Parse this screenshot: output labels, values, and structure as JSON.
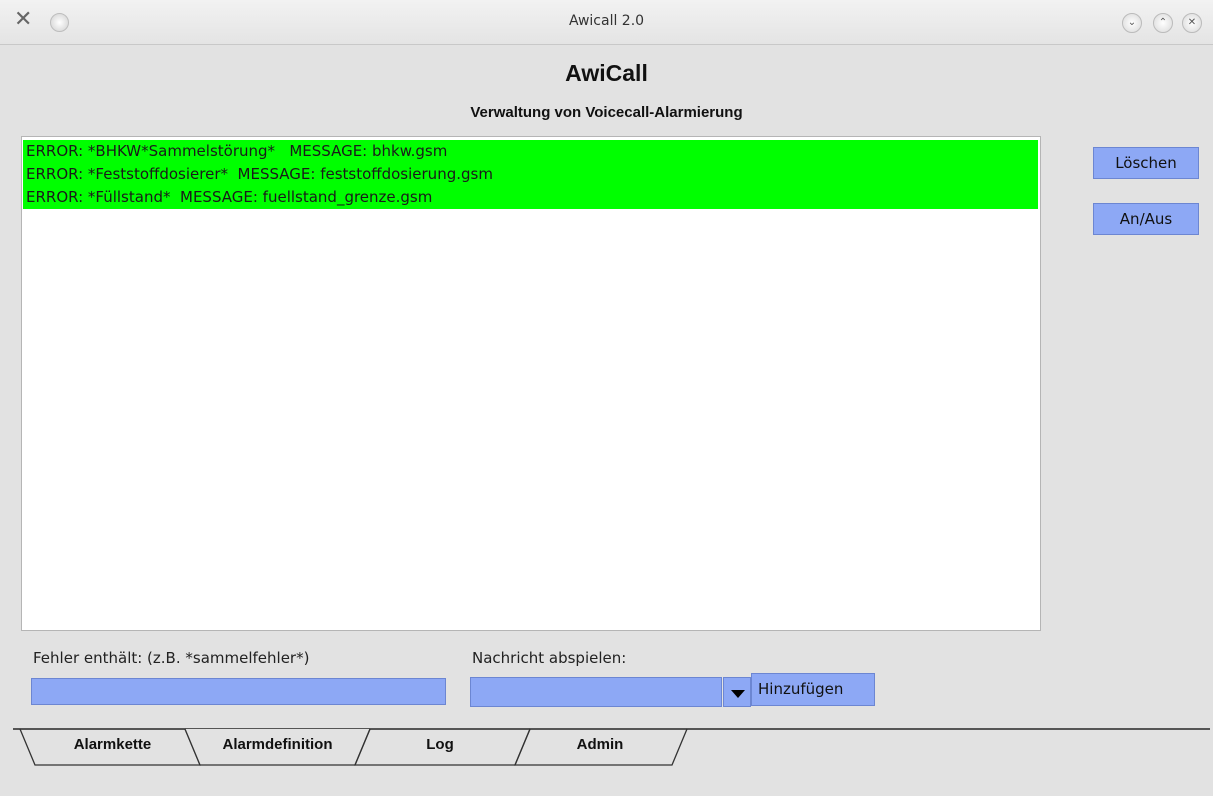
{
  "window": {
    "title": "Awicall 2.0",
    "app_icon": "x-icon",
    "menu_icon": "circle-menu-icon",
    "controls": [
      "minimize-icon",
      "maximize-icon",
      "close-icon"
    ]
  },
  "header": {
    "title": "AwiCall",
    "subtitle": "Verwaltung von Voicecall-Alarmierung"
  },
  "definitions": [
    "ERROR: *BHKW*Sammelstörung*   MESSAGE: bhkw.gsm",
    "ERROR: *Feststoffdosierer*  MESSAGE: feststoffdosierung.gsm",
    "ERROR: *Füllstand*  MESSAGE: fuellstand_grenze.gsm"
  ],
  "buttons": {
    "delete": "Löschen",
    "toggle": "An/Aus",
    "add": "Hinzufügen"
  },
  "form": {
    "error_label": "Fehler enthält: (z.B. *sammelfehler*)",
    "error_value": "",
    "message_label": "Nachricht abspielen:",
    "message_value": ""
  },
  "tabs": [
    {
      "label": "Alarmkette",
      "active": false
    },
    {
      "label": "Alarmdefinition",
      "active": true
    },
    {
      "label": "Log",
      "active": false
    },
    {
      "label": "Admin",
      "active": false
    }
  ],
  "colors": {
    "highlight": "#00ff00",
    "widget": "#8da8f5",
    "background": "#e2e2e2"
  }
}
